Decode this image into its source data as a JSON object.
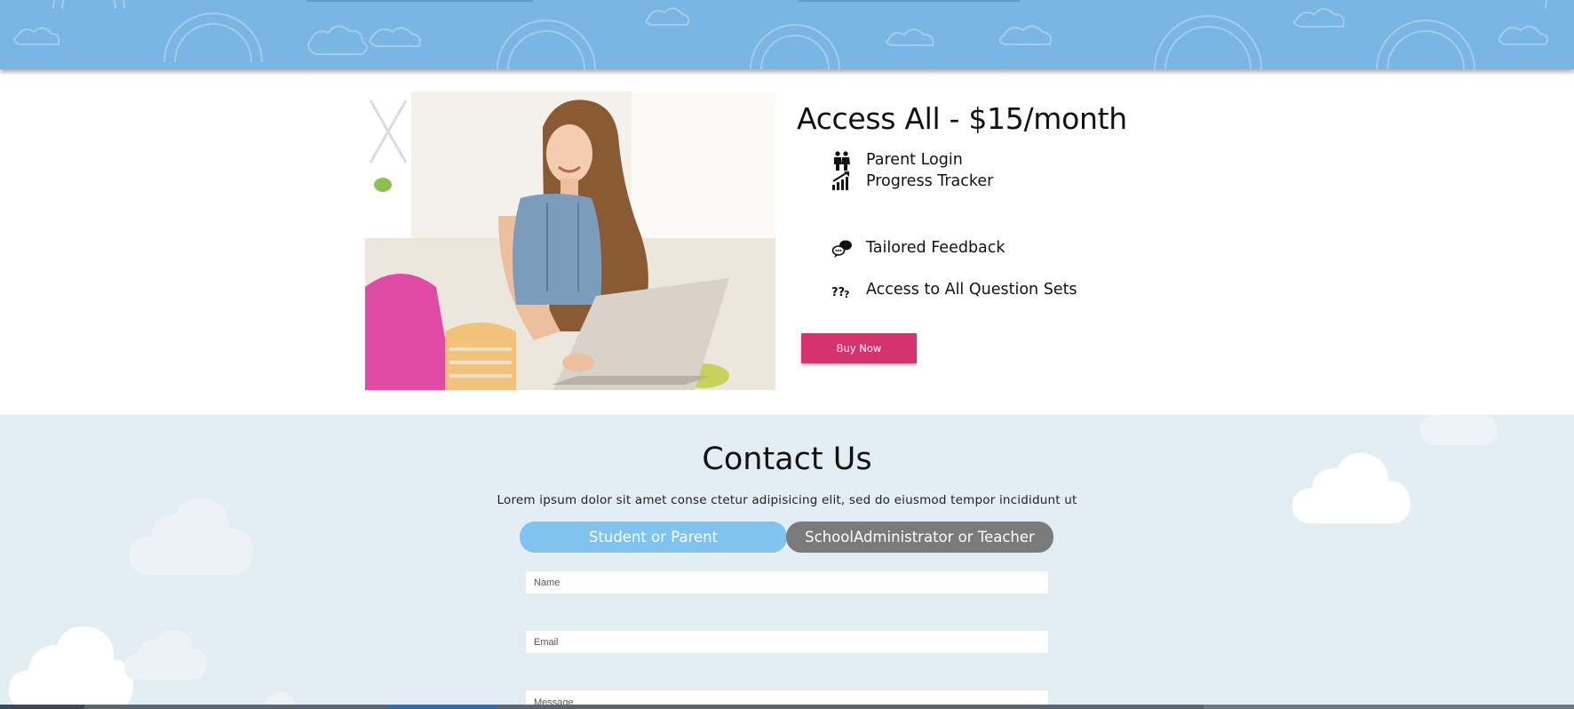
{
  "plan": {
    "title": "Access All - $15/month",
    "features": [
      {
        "label": "Parent Login",
        "icon": "parents-icon"
      },
      {
        "label": "Progress Tracker",
        "icon": "growth-chart-icon"
      },
      {
        "label": "Tailored Feedback",
        "icon": "speech-bubbles-icon"
      },
      {
        "label": "Access to All Question Sets",
        "icon": "question-marks-icon"
      }
    ],
    "buy_label": "Buy Now"
  },
  "contact": {
    "title": "Contact Us",
    "subtitle": "Lorem ipsum dolor sit amet conse ctetur adipisicing elit, sed do eiusmod tempor incididunt ut",
    "tabs": {
      "student": "Student or Parent",
      "school": "SchoolAdministrator or Teacher"
    },
    "form": {
      "name_placeholder": "Name",
      "email_placeholder": "Email",
      "message_placeholder": "Message"
    }
  },
  "colors": {
    "sky_band": "#7ab6e3",
    "buy_button": "#d4336f",
    "tab_active": "#7fc3ee",
    "tab_inactive": "#7a7a7a",
    "contact_bg": "#e2edf4"
  }
}
